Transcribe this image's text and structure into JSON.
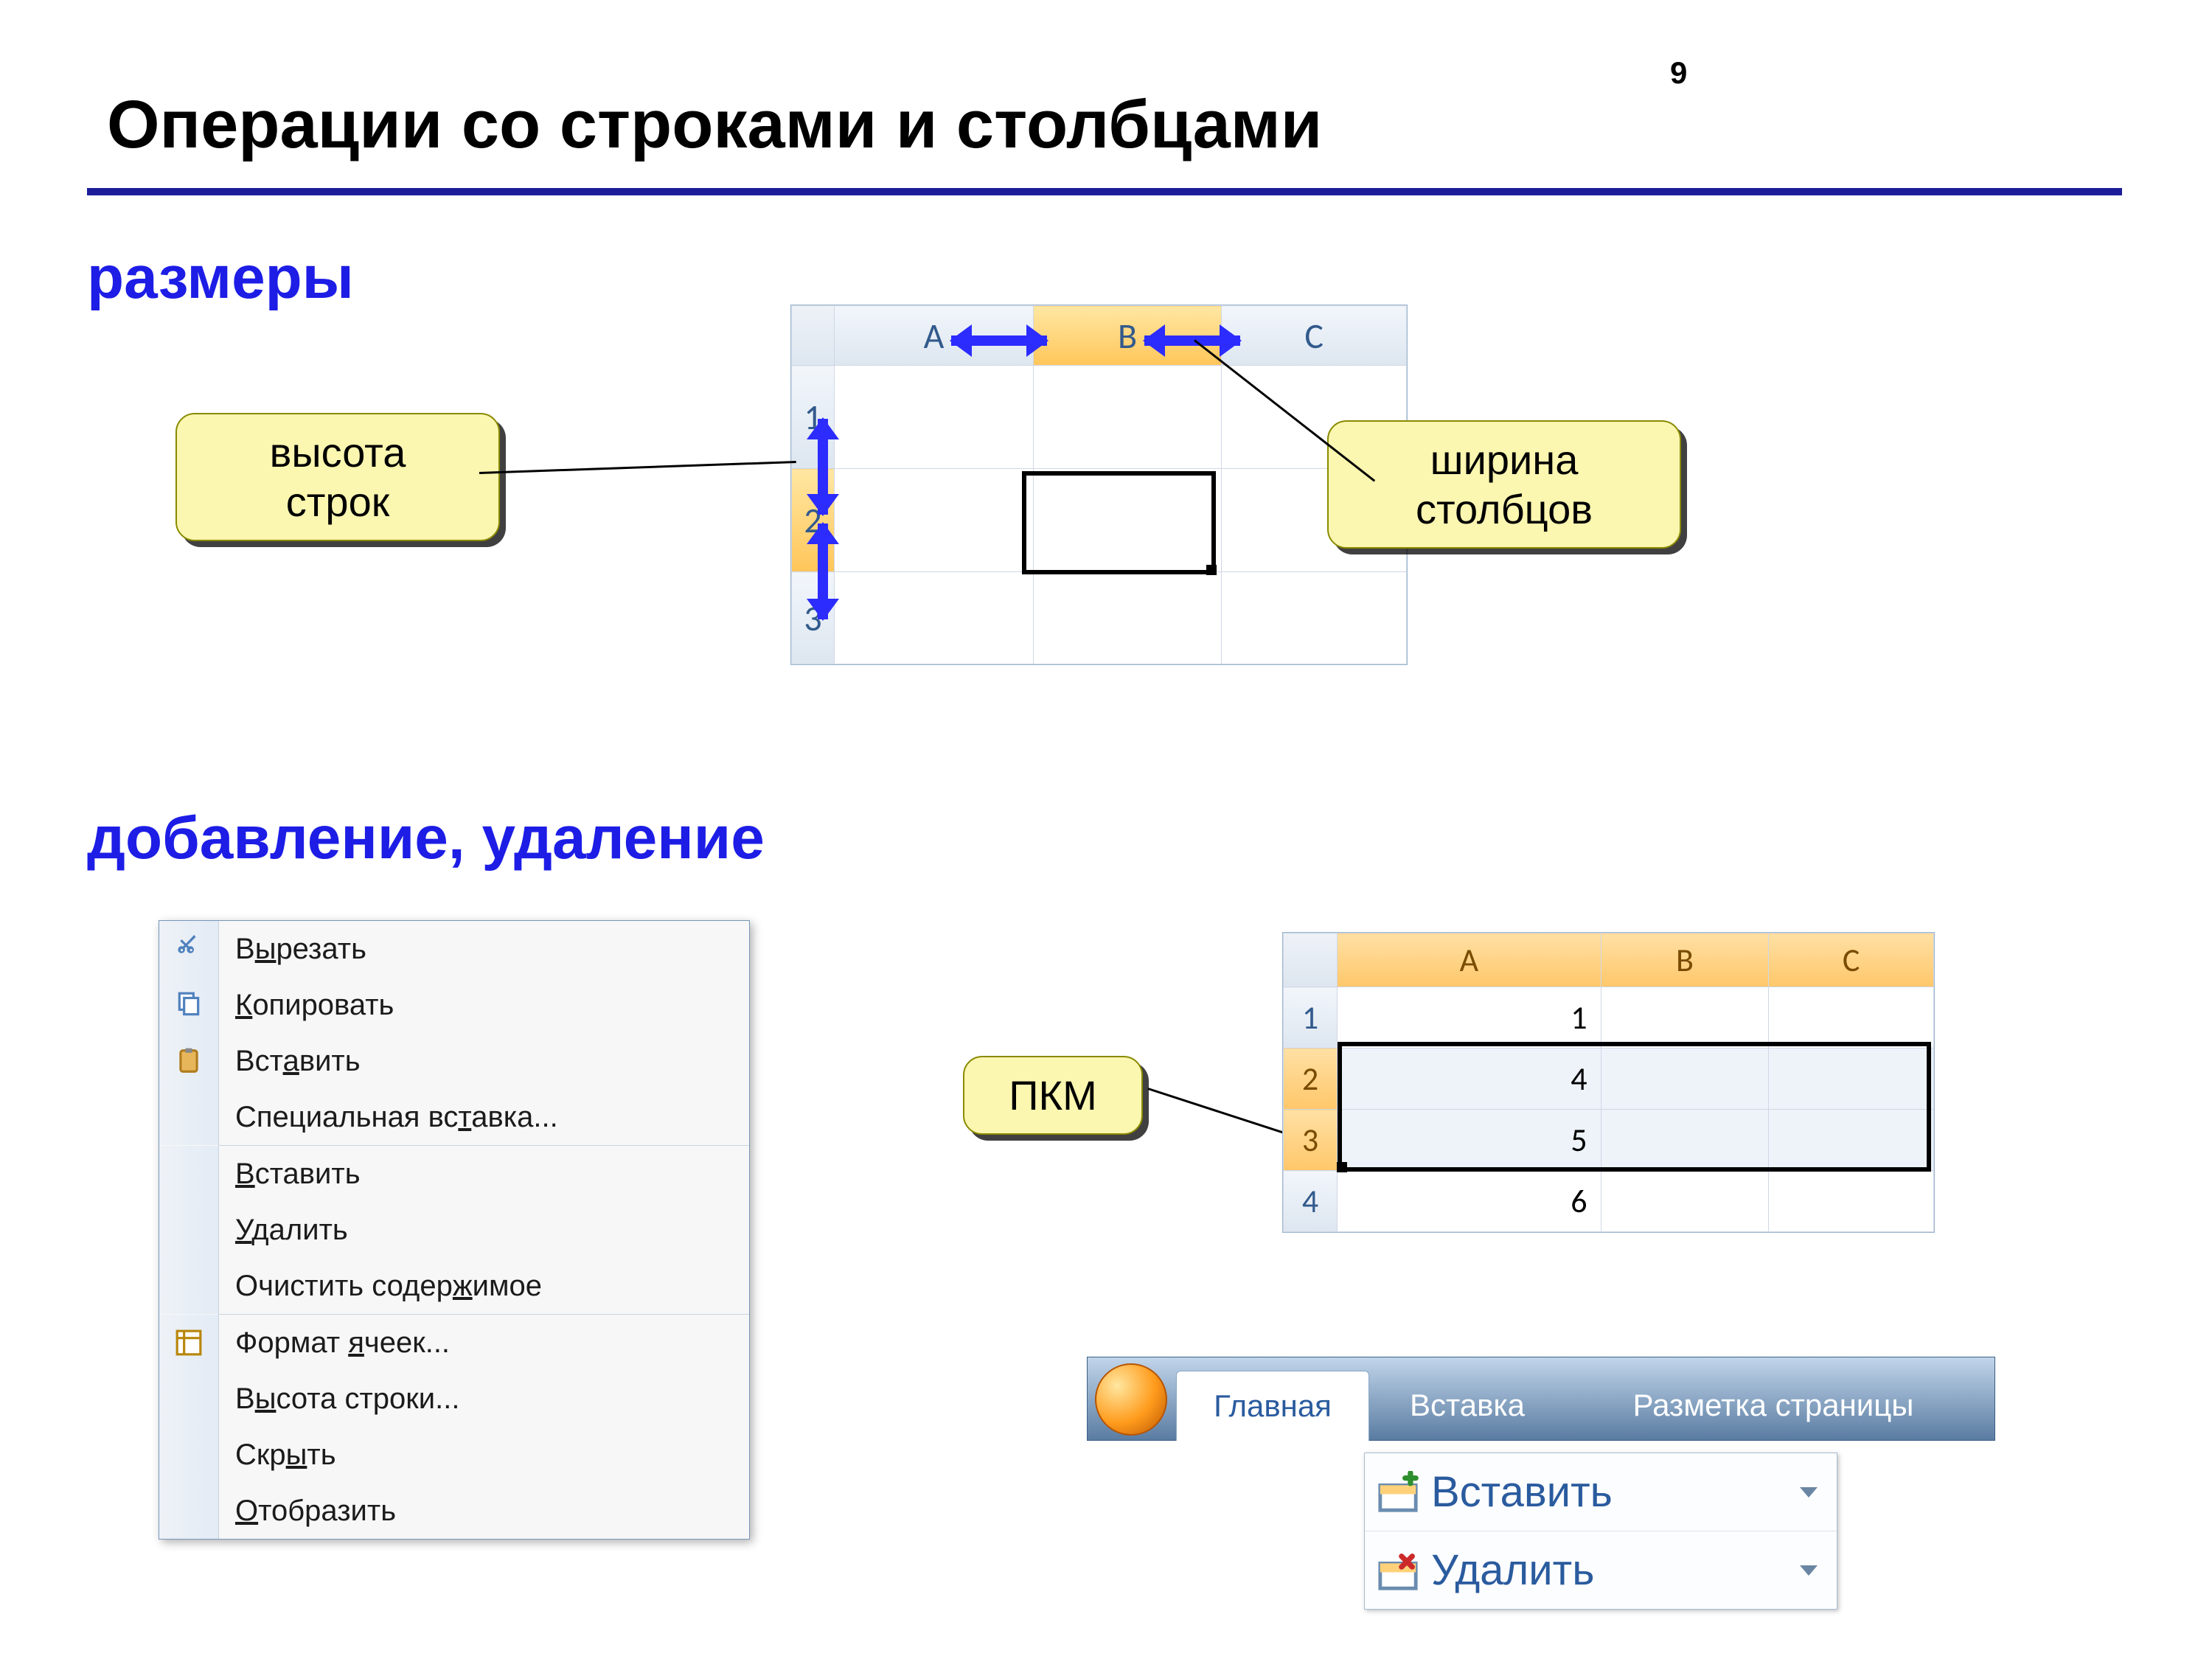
{
  "page_number": "9",
  "title": "Операции со строками и столбцами",
  "sections": {
    "sizes": "размеры",
    "add_del": "добавление, удаление"
  },
  "callouts": {
    "row_height": "высота\nстрок",
    "col_width": "ширина\nстолбцов",
    "rmb": "ПКМ"
  },
  "grid1": {
    "cols": [
      "A",
      "B",
      "C"
    ],
    "rows": [
      "1",
      "2",
      "3"
    ]
  },
  "ctx_menu": {
    "cut": "Вырезать",
    "copy": "Копировать",
    "paste": "Вставить",
    "paste_special": "Специальная вставка...",
    "insert": "Вставить",
    "delete": "Удалить",
    "clear": "Очистить содержимое",
    "format_cells": "Формат ячеек...",
    "row_height": "Высота строки...",
    "hide": "Скрыть",
    "unhide": "Отобразить"
  },
  "grid2": {
    "cols": [
      "A",
      "B",
      "C"
    ],
    "rows": [
      {
        "n": "1",
        "a": "1"
      },
      {
        "n": "2",
        "a": "4"
      },
      {
        "n": "3",
        "a": "5"
      },
      {
        "n": "4",
        "a": "6"
      }
    ]
  },
  "ribbon": {
    "t1": "Главная",
    "t2": "Вставка",
    "t3": "Разметка страницы"
  },
  "buttons": {
    "insert": "Вставить",
    "delete": "Удалить"
  }
}
